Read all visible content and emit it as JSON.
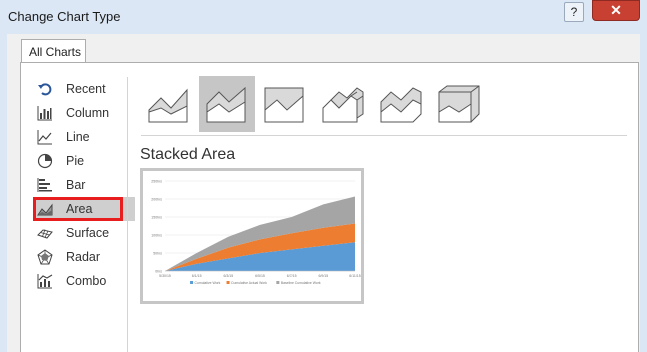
{
  "window": {
    "title": "Change Chart Type",
    "help_glyph": "?",
    "close_glyph": "✕"
  },
  "tabs": [
    {
      "label": "All Charts"
    }
  ],
  "chart_types": [
    {
      "label": "Recent",
      "icon": "recent-icon"
    },
    {
      "label": "Column",
      "icon": "column-chart-icon"
    },
    {
      "label": "Line",
      "icon": "line-chart-icon"
    },
    {
      "label": "Pie",
      "icon": "pie-chart-icon"
    },
    {
      "label": "Bar",
      "icon": "bar-chart-icon"
    },
    {
      "label": "Area",
      "icon": "area-chart-icon",
      "selected": true
    },
    {
      "label": "Surface",
      "icon": "surface-chart-icon"
    },
    {
      "label": "Radar",
      "icon": "radar-chart-icon"
    },
    {
      "label": "Combo",
      "icon": "combo-chart-icon"
    }
  ],
  "subtypes": [
    {
      "icon": "area-icon"
    },
    {
      "icon": "stacked-area-icon",
      "selected": true
    },
    {
      "icon": "100-stacked-area-icon"
    },
    {
      "icon": "3d-area-icon"
    },
    {
      "icon": "3d-stacked-area-icon"
    },
    {
      "icon": "3d-100-stacked-area-icon"
    }
  ],
  "selected_subtype_title": "Stacked Area",
  "preview": {
    "chart_data": {
      "type": "area",
      "stacked": true,
      "x": [
        "5/30/15",
        "6/1/15",
        "6/3/15",
        "6/5/15",
        "6/7/15",
        "6/9/15",
        "6/11/15"
      ],
      "series": [
        {
          "name": "Cumulative Work",
          "color": "#5b9bd5",
          "values": [
            0,
            20,
            35,
            50,
            60,
            70,
            80
          ]
        },
        {
          "name": "Cumulative Actual Work",
          "color": "#ed7d31",
          "values": [
            0,
            14,
            30,
            38,
            45,
            50,
            52
          ]
        },
        {
          "name": "Baseline Cumulative Work",
          "color": "#a5a5a5",
          "values": [
            0,
            16,
            30,
            40,
            45,
            65,
            75
          ]
        }
      ],
      "ylim": [
        0,
        250
      ],
      "y_ticks": [
        "0hrs",
        "50hrs",
        "100hrs",
        "150hrs",
        "200hrs",
        "250hrs"
      ],
      "grid": true,
      "legend": "bottom"
    }
  }
}
